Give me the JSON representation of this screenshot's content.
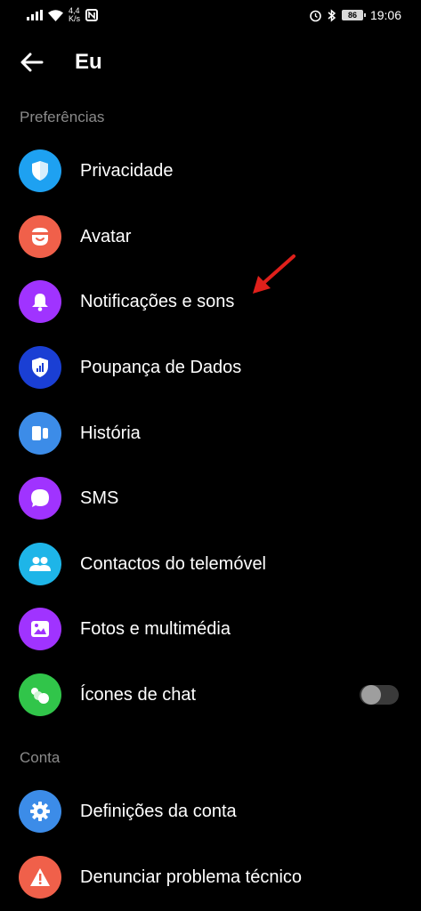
{
  "status_bar": {
    "speed_value": "4,4",
    "speed_unit": "K/s",
    "battery": "86",
    "time": "19:06",
    "icons": [
      "signal-icon",
      "wifi-icon",
      "nfc-icon",
      "alarm-icon",
      "bluetooth-icon",
      "battery-icon"
    ]
  },
  "header": {
    "title": "Eu",
    "back_icon": "back-arrow-icon"
  },
  "sections": {
    "preferences_label": "Preferências",
    "account_label": "Conta"
  },
  "preferences": [
    {
      "label": "Privacidade",
      "icon": "shield-icon",
      "color": "#1ea1f1"
    },
    {
      "label": "Avatar",
      "icon": "avatar-face-icon",
      "color": "#f0604a"
    },
    {
      "label": "Notificações e sons",
      "icon": "bell-icon",
      "color": "#a033ff"
    },
    {
      "label": "Poupança de Dados",
      "icon": "data-saver-icon",
      "color": "#1a3fd4"
    },
    {
      "label": "História",
      "icon": "story-icon",
      "color": "#3c8ce8"
    },
    {
      "label": "SMS",
      "icon": "sms-bubble-icon",
      "color": "#a033ff"
    },
    {
      "label": "Contactos do telemóvel",
      "icon": "contacts-icon",
      "color": "#1eb5e8"
    },
    {
      "label": "Fotos e multimédia",
      "icon": "photo-icon",
      "color": "#a033ff"
    },
    {
      "label": "Ícones de chat",
      "icon": "chat-heads-icon",
      "color": "#31c54a",
      "toggle_on": false
    }
  ],
  "account": [
    {
      "label": "Definições da conta",
      "icon": "gear-icon",
      "color": "#3c8ce8"
    },
    {
      "label": "Denunciar problema técnico",
      "icon": "warning-icon",
      "color": "#f0604a"
    }
  ],
  "annotation": {
    "arrow_color": "#e0201b"
  }
}
